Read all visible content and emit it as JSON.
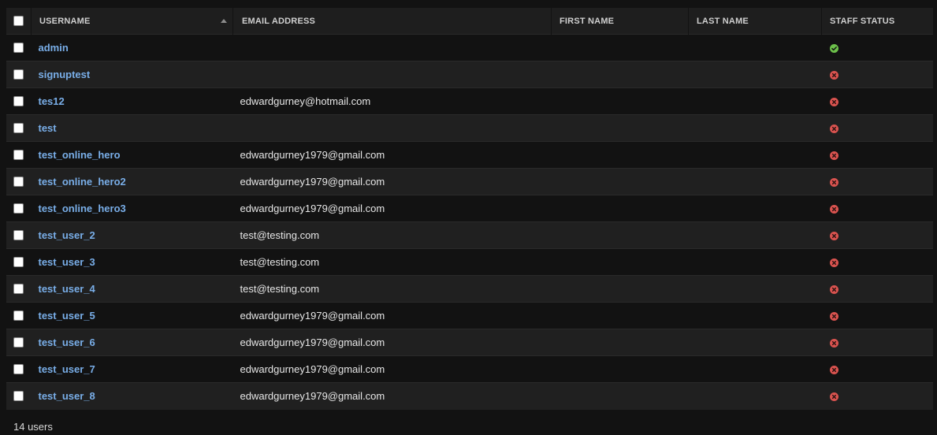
{
  "columns": {
    "username": "USERNAME",
    "email": "EMAIL ADDRESS",
    "first_name": "FIRST NAME",
    "last_name": "LAST NAME",
    "staff_status": "STAFF STATUS"
  },
  "rows": [
    {
      "username": "admin",
      "email": "",
      "first_name": "",
      "last_name": "",
      "staff": true
    },
    {
      "username": "signuptest",
      "email": "",
      "first_name": "",
      "last_name": "",
      "staff": false
    },
    {
      "username": "tes12",
      "email": "edwardgurney@hotmail.com",
      "first_name": "",
      "last_name": "",
      "staff": false
    },
    {
      "username": "test",
      "email": "",
      "first_name": "",
      "last_name": "",
      "staff": false
    },
    {
      "username": "test_online_hero",
      "email": "edwardgurney1979@gmail.com",
      "first_name": "",
      "last_name": "",
      "staff": false
    },
    {
      "username": "test_online_hero2",
      "email": "edwardgurney1979@gmail.com",
      "first_name": "",
      "last_name": "",
      "staff": false
    },
    {
      "username": "test_online_hero3",
      "email": "edwardgurney1979@gmail.com",
      "first_name": "",
      "last_name": "",
      "staff": false
    },
    {
      "username": "test_user_2",
      "email": "test@testing.com",
      "first_name": "",
      "last_name": "",
      "staff": false
    },
    {
      "username": "test_user_3",
      "email": "test@testing.com",
      "first_name": "",
      "last_name": "",
      "staff": false
    },
    {
      "username": "test_user_4",
      "email": "test@testing.com",
      "first_name": "",
      "last_name": "",
      "staff": false
    },
    {
      "username": "test_user_5",
      "email": "edwardgurney1979@gmail.com",
      "first_name": "",
      "last_name": "",
      "staff": false
    },
    {
      "username": "test_user_6",
      "email": "edwardgurney1979@gmail.com",
      "first_name": "",
      "last_name": "",
      "staff": false
    },
    {
      "username": "test_user_7",
      "email": "edwardgurney1979@gmail.com",
      "first_name": "",
      "last_name": "",
      "staff": false
    },
    {
      "username": "test_user_8",
      "email": "edwardgurney1979@gmail.com",
      "first_name": "",
      "last_name": "",
      "staff": false
    }
  ],
  "footer": {
    "count_text": "14 users"
  },
  "colors": {
    "link": "#79aee8",
    "staff_yes": "#6cc04a",
    "staff_no": "#d9534f"
  }
}
